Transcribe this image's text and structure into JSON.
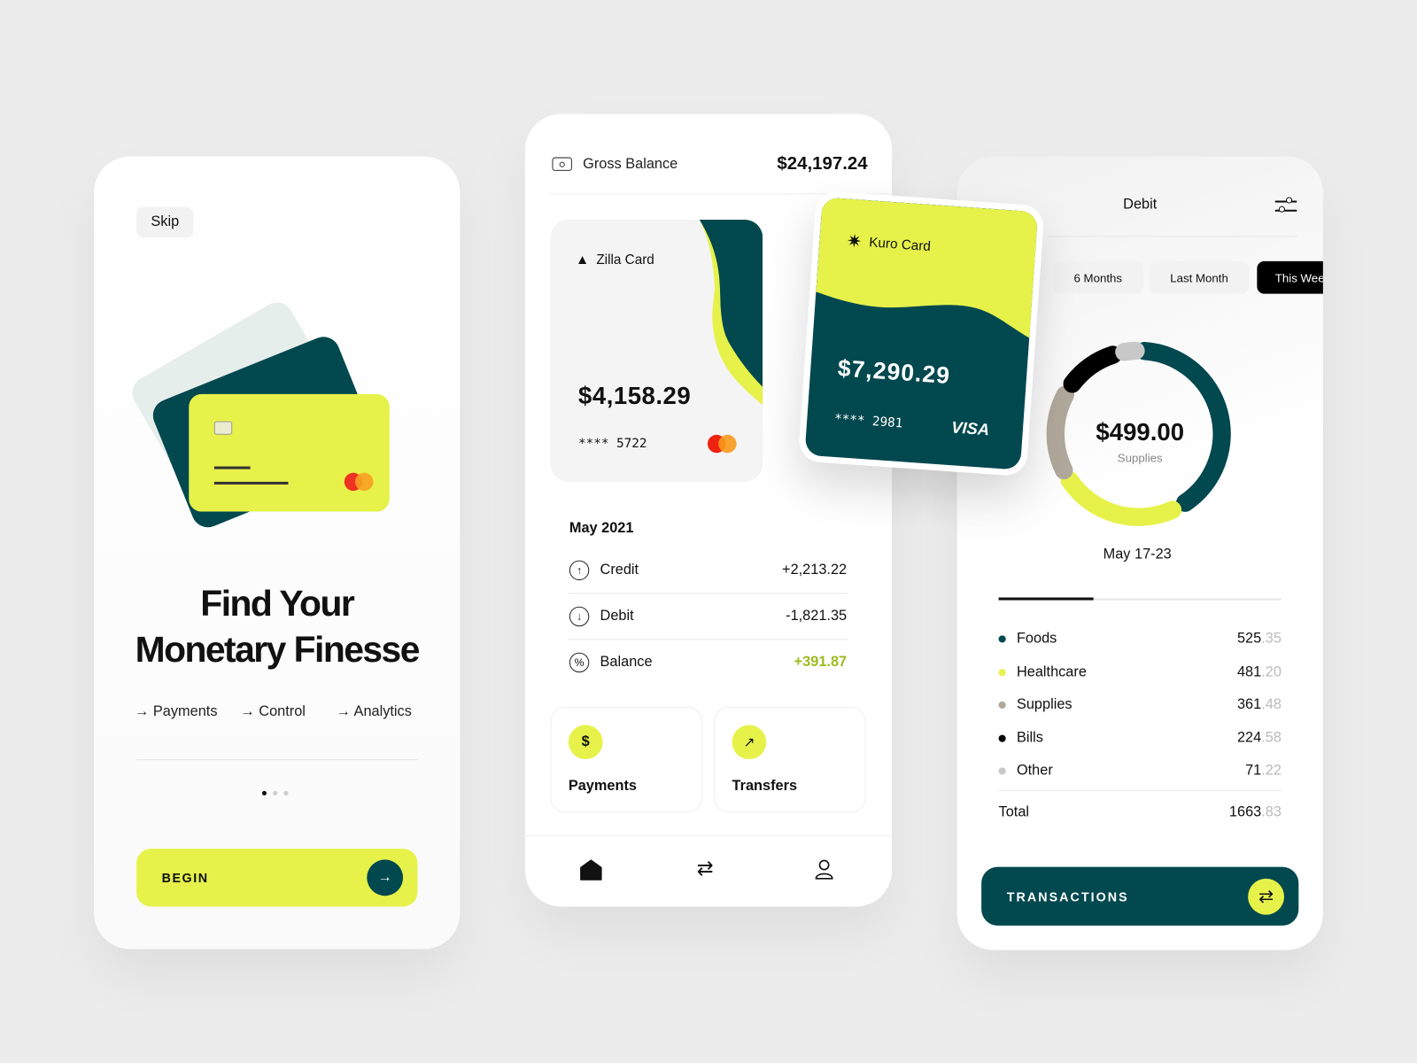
{
  "colors": {
    "lime": "#e6f24a",
    "teal": "#02484f",
    "background": "#ececec"
  },
  "onboarding": {
    "skip": "Skip",
    "title_line1": "Find Your",
    "title_line2": "Monetary Finesse",
    "features": [
      "Payments",
      "Control",
      "Analytics"
    ],
    "page_indicator": {
      "total": 3,
      "active": 1
    },
    "begin": "BEGIN"
  },
  "wallet": {
    "gross_label": "Gross Balance",
    "gross_value": "$24,197.24",
    "zilla": {
      "name": "Zilla Card",
      "balance": "$4,158.29",
      "number": "**** 5722",
      "network": "mastercard"
    },
    "kuro": {
      "name": "Kuro Card",
      "balance": "$7,290.29",
      "number": "**** 2981",
      "network": "VISA"
    },
    "month": "May 2021",
    "rows": [
      {
        "label": "Credit",
        "value": "+2,213.22",
        "icon": "arrow-up-circle"
      },
      {
        "label": "Debit",
        "value": "-1,821.35",
        "icon": "arrow-down-circle"
      },
      {
        "label": "Balance",
        "value": "+391.87",
        "icon": "percent-circle"
      }
    ],
    "actions": [
      {
        "label": "Payments",
        "icon": "dollar-icon"
      },
      {
        "label": "Transfers",
        "icon": "arrow-up-right-icon"
      }
    ],
    "nav": [
      "home-icon",
      "transfer-icon",
      "profile-icon"
    ]
  },
  "debit": {
    "title": "Debit",
    "tabs": [
      "6 Months",
      "Last Month",
      "This Week"
    ],
    "active_tab": "This Week",
    "amount": "$499.00",
    "amount_label": "Supplies",
    "range": "May 17-23",
    "categories": [
      {
        "name": "Foods",
        "int": "525",
        "dec": ".35",
        "color": "#02484f"
      },
      {
        "name": "Healthcare",
        "int": "481",
        "dec": ".20",
        "color": "#e6f24a"
      },
      {
        "name": "Supplies",
        "int": "361",
        "dec": ".48",
        "color": "#b0a89a"
      },
      {
        "name": "Bills",
        "int": "224",
        "dec": ".58",
        "color": "#000000"
      },
      {
        "name": "Other",
        "int": "71",
        "dec": ".22",
        "color": "#c8c8c8"
      }
    ],
    "total_label": "Total",
    "total_int": "1663",
    "total_dec": ".83",
    "button": "TRANSACTIONS"
  }
}
